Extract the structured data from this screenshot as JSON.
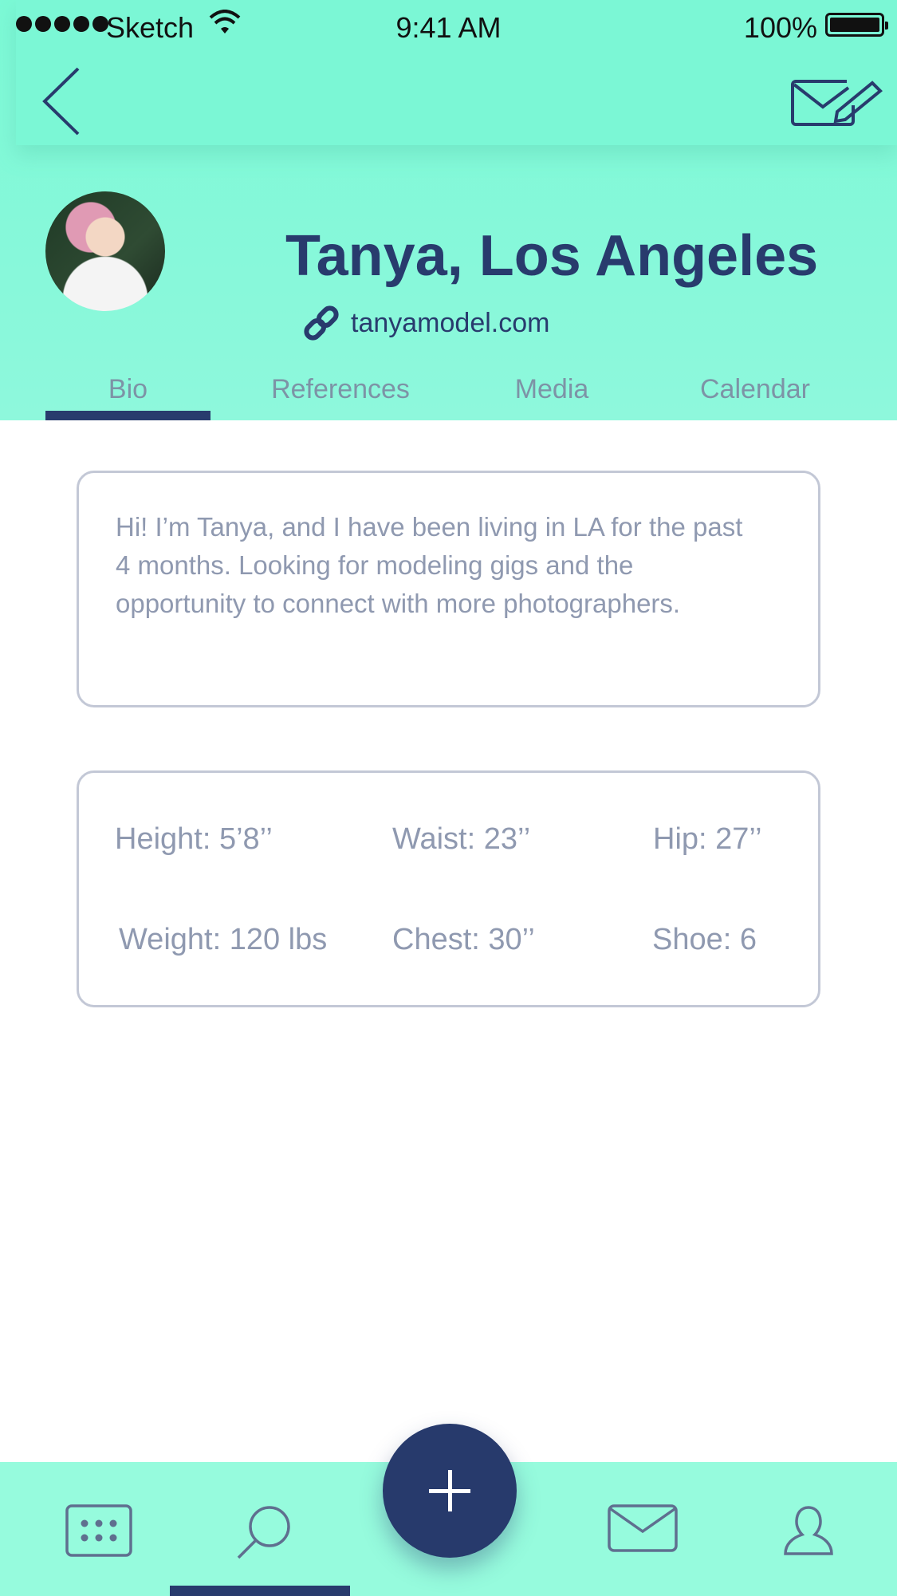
{
  "status_bar": {
    "carrier": "Sketch",
    "time": "9:41 AM",
    "battery": "100%"
  },
  "nav": {
    "back_icon": "chevron-left-icon",
    "compose_icon": "envelope-pencil-icon"
  },
  "profile": {
    "name": "Tanya, Los Angeles",
    "website": "tanyamodel.com",
    "link_icon": "link-icon"
  },
  "tabs": [
    {
      "label": "Bio",
      "active": true
    },
    {
      "label": "References",
      "active": false
    },
    {
      "label": "Media",
      "active": false
    },
    {
      "label": "Calendar",
      "active": false
    }
  ],
  "bio": {
    "text": "Hi! I’m Tanya, and I have been living in LA for the past 4 months. Looking for modeling gigs and the opportunity to connect with more photographers."
  },
  "stats": {
    "height": "Height: 5’8’’",
    "waist": "Waist: 23’’",
    "hip": "Hip: 27’’",
    "weight": "Weight: 120 lbs",
    "chest": "Chest: 30’’",
    "shoe": "Shoe: 6"
  },
  "bottom_nav": {
    "items": [
      "calendar-icon",
      "search-icon",
      "plus-icon",
      "mail-icon",
      "user-icon"
    ],
    "active": "search-icon"
  },
  "colors": {
    "mint": "#7cf9d6",
    "navy": "#283b6d",
    "muted_text": "#8f99b0",
    "tab_text": "#7d93a6"
  }
}
